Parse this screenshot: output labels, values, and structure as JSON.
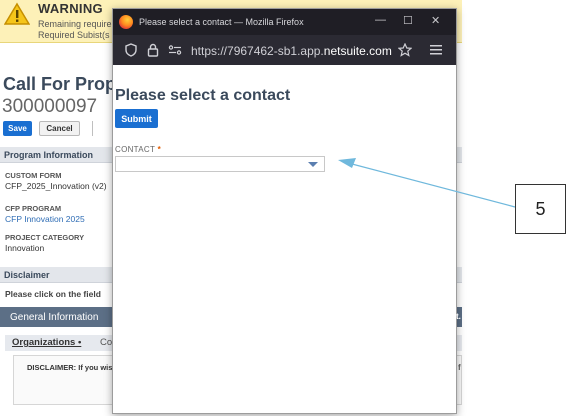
{
  "warning": {
    "title": "WARNING",
    "line1": "Remaining require",
    "line2": "Required Subist(s"
  },
  "record": {
    "type": "Call For Propos",
    "number": "300000097",
    "save_label": "Save",
    "cancel_label": "Cancel"
  },
  "sections": {
    "program_info": "Program Information",
    "disclaimer": "Disclaimer"
  },
  "fields": [
    {
      "label": "CUSTOM FORM",
      "value": "CFP_2025_Innovation (v2)"
    },
    {
      "label": "CFP PROGRAM",
      "value": "CFP Innovation 2025"
    },
    {
      "label": "PROJECT CATEGORY",
      "value": "Innovation"
    }
  ],
  "disclaimer_text": "Please click on the field",
  "general_tab": "General Information",
  "subtabs": {
    "organizations": "Organizations •",
    "second": "Co"
  },
  "disclaimer_box_text": "DISCLAIMER: If you wis",
  "browser": {
    "window_title": "Please select a contact — Mozilla Firefox",
    "url_prefix": "https://7967462-sb1.app.",
    "url_domain": "netsuite.com"
  },
  "dialog": {
    "title": "Please select a contact",
    "submit_label": "Submit",
    "contact_label": "CONTACT",
    "contact_value": ""
  },
  "annotation": {
    "number": "5",
    "color": "#6fb8dc"
  }
}
